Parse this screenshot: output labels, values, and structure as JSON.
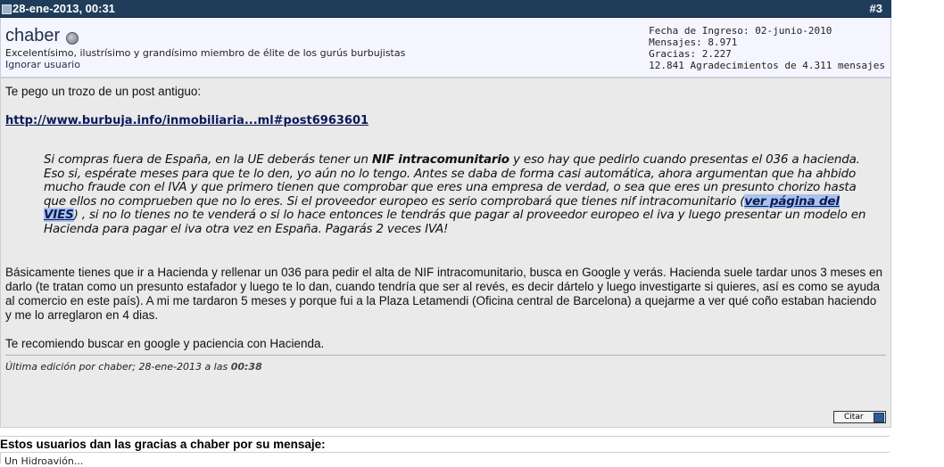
{
  "post": {
    "date": "28-ene-2013, 00:31",
    "number": "#3"
  },
  "user": {
    "name": "chaber",
    "title": "Excelentísimo, ilustrísimo y grandísimo miembro de élite de los gurús burbujistas",
    "ignore": "Ignorar usuario",
    "stats": [
      "Fecha de Ingreso: 02-junio-2010",
      "Mensajes: 8.971",
      "Gracias: 2.227",
      "12.841 Agradecimientos de 4.311 mensajes"
    ]
  },
  "message": {
    "intro": "Te pego un trozo de un post antiguo:",
    "link": "http://www.burbuja.info/inmobiliaria...ml#post6963601",
    "quote": {
      "part1": "Si compras fuera de España, en la UE deberás tener un ",
      "bold": "NIF intracomunitario",
      "part2": " y eso hay que pedirlo cuando presentas el 036 a hacienda. Eso si, espérate meses para que te lo den, yo aún no lo tengo. Antes se daba de forma casi automática, ahora argumentan que ha ahbido mucho fraude con el IVA y que primero tienen que comprobar que eres una empresa de verdad, o sea que eres un presunto chorizo hasta que ellos no comprueben que no lo eres. Si el proveedor europeo es serio comprobará que tienes nif intracomunitario (",
      "link": "ver página del VIES",
      "part3": ") , si no lo tienes no te venderá o si lo hace entonces le tendrás que pagar al proveedor europeo el iva y luego presentar un modelo en Hacienda para pagar el iva otra vez en España. Pagarás 2 veces IVA!"
    },
    "paragraph": "Básicamente tienes que ir a Hacienda y rellenar un 036 para pedir el alta de NIF intracomunitario, busca en Google y verás. Hacienda suele tardar unos 3 meses en darlo (te tratan como un presunto estafador y luego te lo dan, cuando tendría que ser al revés, es decir dártelo y luego investigarte si quieres, así es como se ayuda al comercio en este país). A mi me tardaron 5 meses y porque fui a la Plaza Letamendi (Oficina central de Barcelona) a quejarme a ver qué coño estaban haciendo y me lo arreglaron en 4 dias.",
    "closing": "Te recomiendo buscar en google y paciencia con Hacienda.",
    "edited_prefix": "Última edición por chaber; 28-ene-2013 a las ",
    "edited_time": "00:38"
  },
  "buttons": {
    "quote": "Citar"
  },
  "thanks": {
    "title": "Estos usuarios dan las gracias a chaber por su mensaje:",
    "first_user": "Un Hidroavión..."
  },
  "icons": {
    "post": "post-icon",
    "status": "offline-status-icon",
    "quote": "quote-icon"
  }
}
